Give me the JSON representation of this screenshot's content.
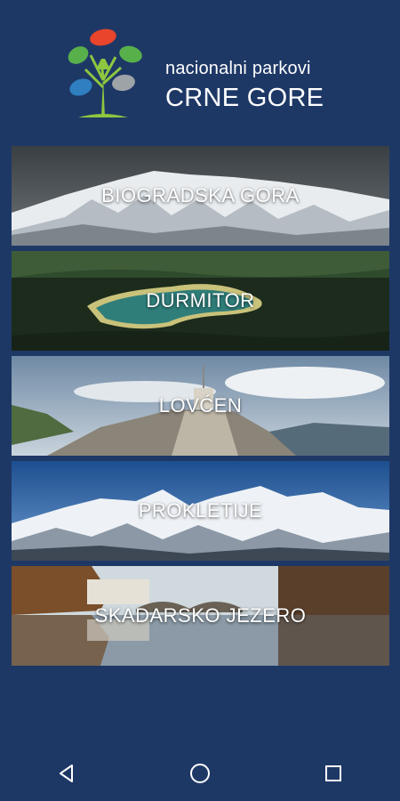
{
  "header": {
    "subtitle": "nacionalni parkovi",
    "title": "CRNE GORE",
    "logo_icon": "tree-logo-icon"
  },
  "parks": [
    {
      "label": "BIOGRADSKA GORA",
      "theme": "snowy-mountain"
    },
    {
      "label": "DURMITOR",
      "theme": "forest-lake"
    },
    {
      "label": "LOVĆEN",
      "theme": "mausoleum-stairs"
    },
    {
      "label": "PROKLETIJE",
      "theme": "snow-peaks"
    },
    {
      "label": "SKADARSKO JEZERO",
      "theme": "lake-bridge"
    }
  ],
  "navbar": {
    "back_icon": "back-triangle-icon",
    "home_icon": "home-circle-icon",
    "recents_icon": "recents-square-icon"
  },
  "colors": {
    "background": "#1e3866",
    "text": "#ffffff"
  }
}
